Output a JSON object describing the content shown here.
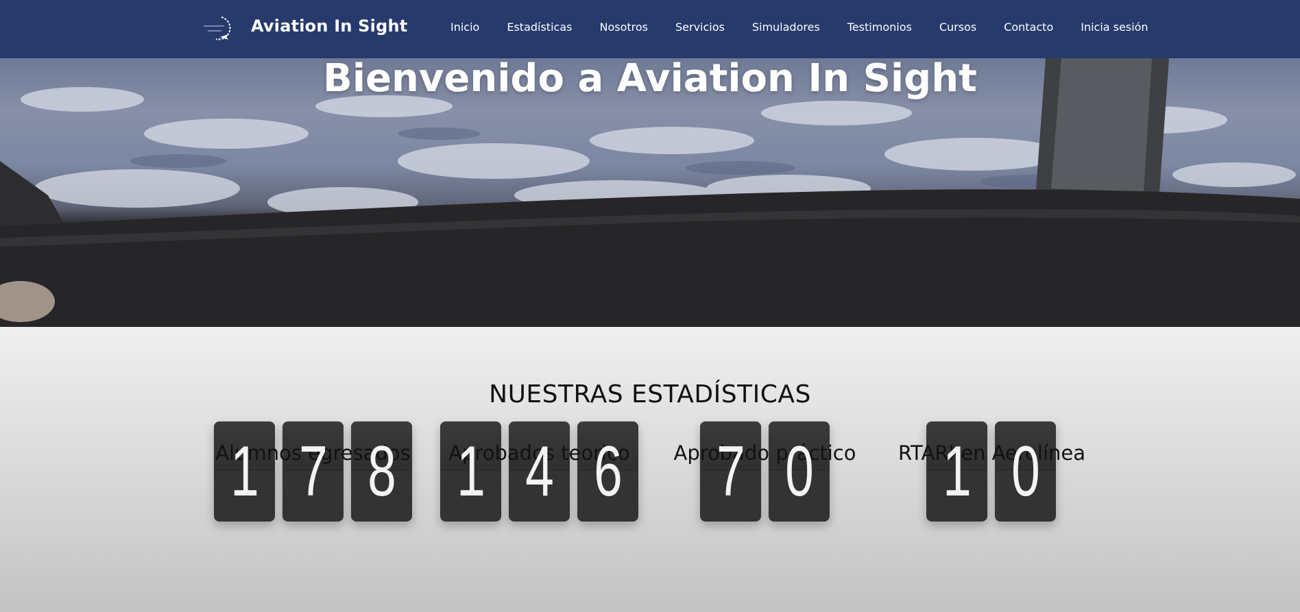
{
  "navbar": {
    "brand": "Aviation In Sight",
    "links": [
      "Inicio",
      "Estadísticas",
      "Nosotros",
      "Servicios",
      "Simuladores",
      "Testimonios",
      "Cursos",
      "Contacto",
      "Inicia sesión"
    ]
  },
  "hero": {
    "title": "Bienvenido a Aviation In Sight"
  },
  "stats": {
    "title": "NUESTRAS ESTADÍSTICAS",
    "items": [
      {
        "digits": [
          "1",
          "7",
          "8"
        ],
        "label": "Alumnos egresados"
      },
      {
        "digits": [
          "1",
          "4",
          "6"
        ],
        "label": "Aprobados teorico"
      },
      {
        "digits": [
          "7",
          "0"
        ],
        "label": "Aprobado práctico"
      },
      {
        "digits": [
          "1",
          "0"
        ],
        "label": "RTARI en Aerolínea"
      }
    ]
  },
  "colors": {
    "navbar": "#263a6c",
    "digit_card": "#333333",
    "text_dark": "#111111"
  }
}
